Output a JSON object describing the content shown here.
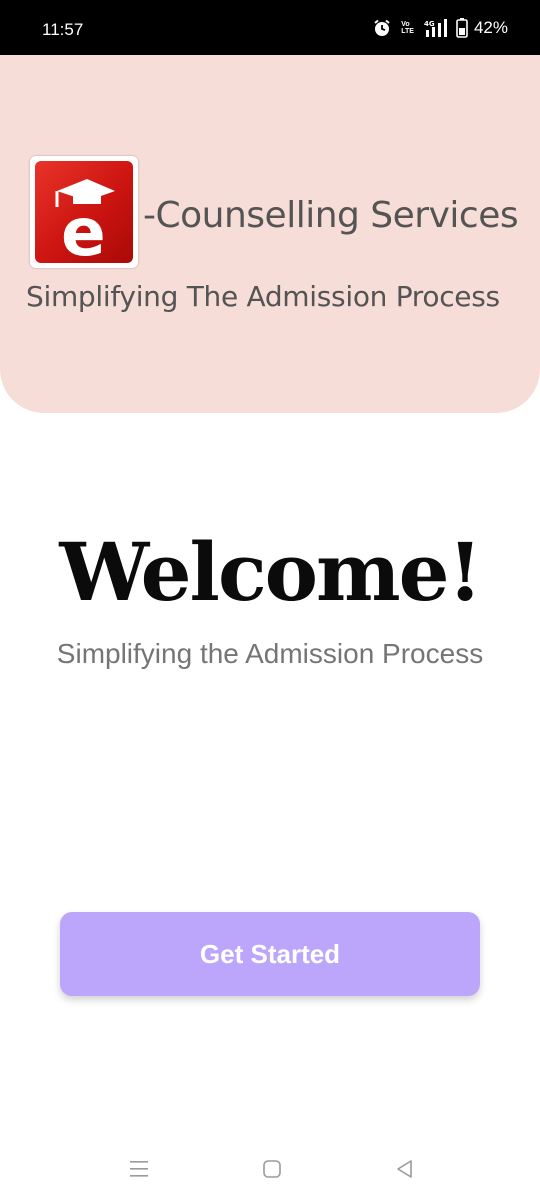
{
  "status_bar": {
    "time": "11:57",
    "volte_top": "Vo",
    "volte_bottom": "LTE",
    "network": "4G",
    "battery": "42%",
    "icons": [
      "alarm-icon",
      "volte-icon",
      "signal-icon",
      "battery-icon"
    ]
  },
  "header": {
    "brand_name": "-Counselling Services",
    "tagline": "Simplifying The Admission Process",
    "logo_letter": "e"
  },
  "welcome": {
    "title": "Welcome!",
    "subtitle": "Simplifying the Admission Process"
  },
  "actions": {
    "get_started_label": "Get Started"
  },
  "nav": {
    "icons": [
      "menu-icon",
      "home-icon",
      "back-icon"
    ]
  },
  "colors": {
    "header_bg": "#f7ddd7",
    "button_bg": "#bba6fb",
    "logo_red": "#cc1410"
  }
}
